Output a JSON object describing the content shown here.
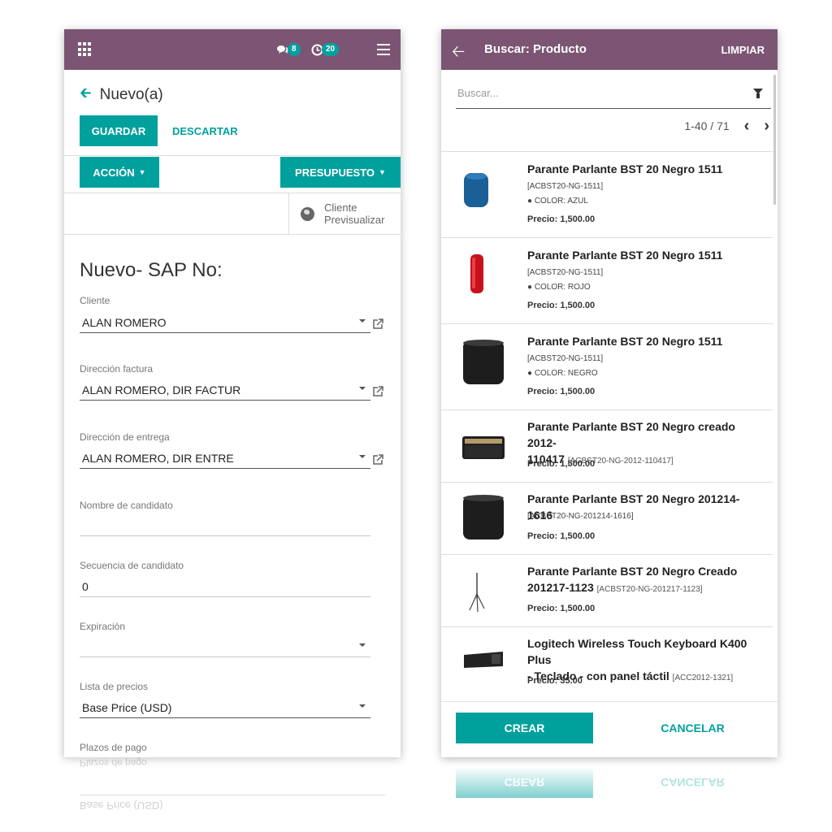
{
  "colors": {
    "topbar": "#7c5574",
    "accent": "#00a09d"
  },
  "left": {
    "topbar": {
      "chat_count": "8",
      "activity_count": "20"
    },
    "breadcrumb": "Nuevo(a)",
    "buttons": {
      "save": "GUARDAR",
      "discard": "DESCARTAR",
      "action": "ACCIÓN",
      "quote": "PRESUPUESTO"
    },
    "preview": {
      "line1": "Cliente",
      "line2": "Previsualizar"
    },
    "title": "Nuevo- SAP No:",
    "fields": {
      "cliente": {
        "label": "Cliente",
        "value": "ALAN ROMERO"
      },
      "factura": {
        "label": "Dirección factura",
        "value": "ALAN ROMERO, DIR FACTUR"
      },
      "entrega": {
        "label": "Dirección de entrega",
        "value": "ALAN ROMERO, DIR ENTRE"
      },
      "nombre": {
        "label": "Nombre de candidato",
        "value": ""
      },
      "secuencia": {
        "label": "Secuencia de candidato",
        "value": "0"
      },
      "expiracion": {
        "label": "Expiración",
        "value": ""
      },
      "precios": {
        "label": "Lista de precios",
        "value": "Base Price (USD)"
      },
      "plazos": {
        "label": "Plazos de pago"
      }
    }
  },
  "right": {
    "topbar": {
      "title": "Buscar: Producto",
      "clear": "LIMPIAR"
    },
    "search": {
      "placeholder": "Buscar..."
    },
    "pager": "1-40 / 71",
    "products": [
      {
        "name": "Parante Parlante BST 20 Negro 1511",
        "ref": "[ACBST20-NG-1511]",
        "attr": "● COLOR: AZUL",
        "price": "Precio: 1,500.00"
      },
      {
        "name": "Parante Parlante BST 20 Negro 1511",
        "ref": "[ACBST20-NG-1511]",
        "attr": "● COLOR: ROJO",
        "price": "Precio: 1,500.00"
      },
      {
        "name": "Parante Parlante BST 20 Negro 1511",
        "ref": "[ACBST20-NG-1511]",
        "attr": "● COLOR: NEGRO",
        "price": "Precio: 1,500.00"
      },
      {
        "name1": "Parante Parlante BST 20 Negro creado 2012-",
        "name2": "110417",
        "ref": "[ACBST20-NG-2012-110417]",
        "price": "Precio: 1,500.00"
      },
      {
        "name": "Parante Parlante BST 20 Negro 201214-1616",
        "ref": "[ACBST20-NG-201214-1616]",
        "price": "Precio: 1,500.00"
      },
      {
        "name1": "Parante Parlante BST 20 Negro Creado",
        "name2": "201217-1123",
        "ref": "[ACBST20-NG-201217-1123]",
        "price": "Precio: 1,500.00"
      },
      {
        "name1": "Logitech Wireless Touch Keyboard K400 Plus",
        "name2": "- Teclado - con panel táctil",
        "ref": "[ACC2012-1321]",
        "price": "Precio: 35.00"
      }
    ],
    "buttons": {
      "create": "CREAR",
      "cancel": "CANCELAR"
    }
  }
}
